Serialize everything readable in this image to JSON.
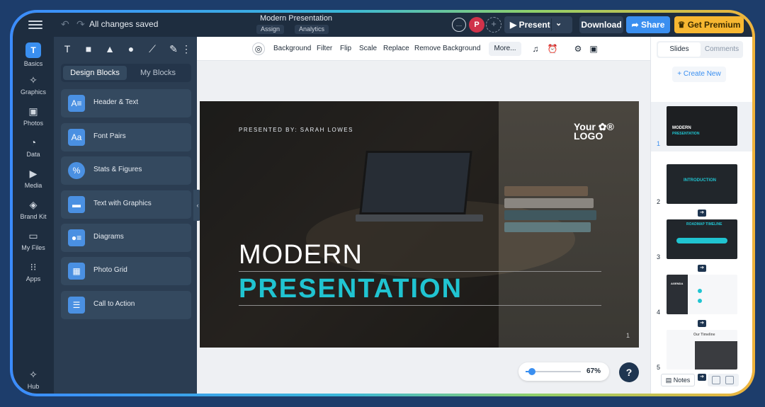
{
  "app": {
    "saved_status": "All changes saved",
    "document_title": "Modern Presentation",
    "assign_label": "Assign",
    "analytics_label": "Analytics"
  },
  "header": {
    "present_label": "Present",
    "download_label": "Download",
    "share_label": "Share",
    "premium_label": "Get Premium",
    "avatar_initial": "P"
  },
  "colors": {
    "accent": "#3a8ff0",
    "premium": "#f7b731",
    "slide_title_accent": "#20c4d1",
    "dark_ui": "#1e2d3f"
  },
  "rail": {
    "items": [
      {
        "label": "Basics",
        "icon": "text-t-icon"
      },
      {
        "label": "Graphics",
        "icon": "graphics-shapes-icon"
      },
      {
        "label": "Photos",
        "icon": "photo-icon"
      },
      {
        "label": "Data",
        "icon": "pie-chart-icon"
      },
      {
        "label": "Media",
        "icon": "media-icon"
      },
      {
        "label": "Brand Kit",
        "icon": "brand-kit-icon"
      },
      {
        "label": "My Files",
        "icon": "folder-icon"
      },
      {
        "label": "Apps",
        "icon": "apps-grid-icon"
      }
    ],
    "hub_label": "Hub"
  },
  "panel": {
    "tabs": [
      "Design Blocks",
      "My Blocks"
    ],
    "blocks": [
      "Header & Text",
      "Font Pairs",
      "Stats & Figures",
      "Text with Graphics",
      "Diagrams",
      "Photo Grid",
      "Call to Action"
    ],
    "block_icons": [
      "A",
      "A",
      "%",
      "",
      "",
      "",
      ""
    ]
  },
  "canvas_toolbar": {
    "items": [
      "Background",
      "Filter",
      "Flip",
      "Scale",
      "Replace",
      "Remove Background"
    ],
    "more_label": "More..."
  },
  "slide": {
    "presented_by": "PRESENTED BY: SARAH LOWES",
    "logo_line1": "Your",
    "logo_line2": "LOGO",
    "title_line1": "MODERN",
    "title_line2": "PRESENTATION",
    "number": "1"
  },
  "zoom": {
    "value": "67%",
    "level": 0.12
  },
  "help_label": "?",
  "right_panel": {
    "tabs": [
      "Slides",
      "Comments"
    ],
    "create_label": "+ Create New",
    "thumbs": [
      {
        "num": "1",
        "text": "MODERN"
      },
      {
        "num": "2",
        "text": "INTRODUCTION"
      },
      {
        "num": "3",
        "text": "ROADMAP TIMELINE"
      },
      {
        "num": "4",
        "text": "AGENDA"
      },
      {
        "num": "5",
        "text": "Our Timeline"
      }
    ],
    "notes_label": "Notes"
  }
}
